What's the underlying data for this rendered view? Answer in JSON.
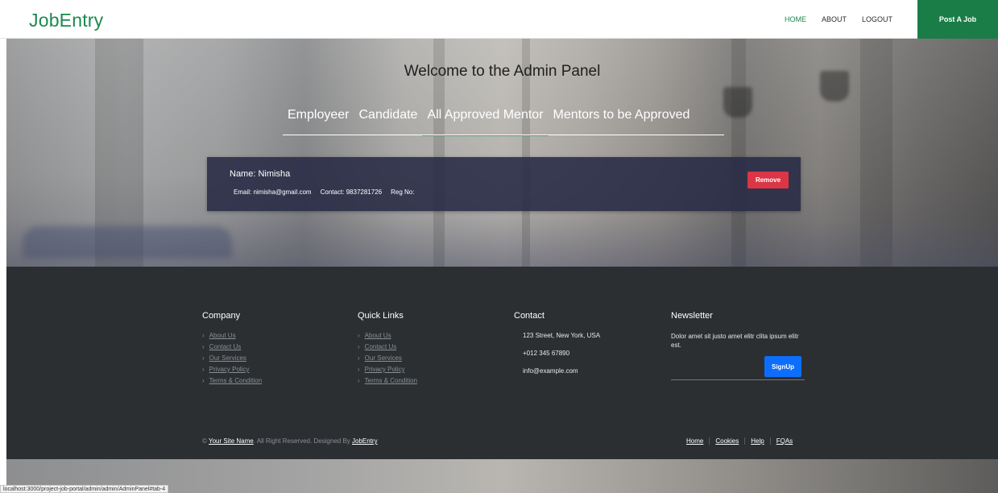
{
  "navbar": {
    "brand": "JobEntry",
    "links": [
      {
        "label": "HOME"
      },
      {
        "label": "ABOUT"
      },
      {
        "label": "LOGOUT"
      }
    ],
    "post_job_label": "Post A Job"
  },
  "hero": {
    "title": "Welcome to the Admin Panel",
    "tabs": [
      {
        "label": "Employeer"
      },
      {
        "label": "Candidate"
      },
      {
        "label": "All Approved Mentor"
      },
      {
        "label": "Mentors to be Approved"
      }
    ],
    "active_tab": "All Approved Mentor"
  },
  "mentor": {
    "name": "Name: Nimisha",
    "email": "Email: nimisha@gmail.com",
    "contact": "Contact: 9837281726",
    "reg_no": "Reg No:",
    "remove_label": "Remove"
  },
  "footer": {
    "company": {
      "title": "Company",
      "links": [
        "About Us",
        "Contact Us",
        "Our Services",
        "Privacy Policy",
        "Terms & Condition"
      ]
    },
    "quick_links": {
      "title": "Quick Links",
      "links": [
        "About Us",
        "Contact Us",
        "Our Services",
        "Privacy Policy",
        "Terms & Condition"
      ]
    },
    "contact": {
      "title": "Contact",
      "address": "123 Street, New York, USA",
      "phone": "+012 345 67890",
      "email": "info@example.com"
    },
    "newsletter": {
      "title": "Newsletter",
      "text": "Dolor amet sit justo amet elitr clita ipsum elitr est.",
      "signup_label": "SignUp"
    },
    "copyright": {
      "prefix": "©",
      "site_name": "Your Site Name",
      "middle": ". All Right Reserved. Designed By",
      "designer": "JobEntry"
    },
    "menu": [
      "Home",
      "Cookies",
      "Help",
      "FQAs"
    ]
  },
  "status_bar": {
    "url": "localhost:3000/project-job-portal/admin/admin/AdminPanel#tab-4"
  },
  "colors": {
    "brand_green": "#1a8a4e",
    "post_button": "#1a7d47",
    "remove_button": "#dc3545",
    "signup_button": "#0d6efd",
    "footer_bg": "#2b2f32"
  }
}
